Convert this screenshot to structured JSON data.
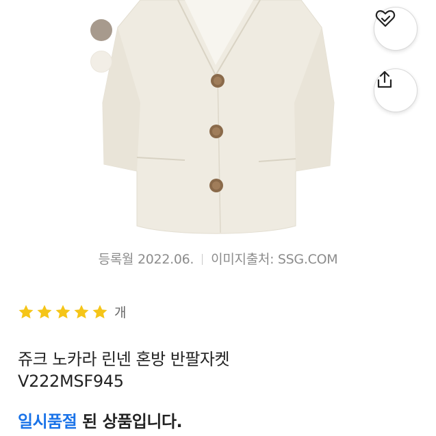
{
  "product": {
    "image_alt": "ivory linen short-sleeve jacket",
    "swatches": [
      {
        "name": "beige",
        "color": "#a79a8d"
      },
      {
        "name": "ivory",
        "color": "#f2eee6"
      }
    ],
    "actions": {
      "wishlist_icon": "heart-check-icon",
      "share_icon": "share-icon"
    }
  },
  "meta": {
    "registered": "등록월 2022.06.",
    "source": "이미지출처: SSG.COM"
  },
  "rating": {
    "stars": 5,
    "count_label": "개"
  },
  "title": "쥬크 노카라 린넨 혼방 반팔자켓",
  "code": "V222MSF945",
  "status": {
    "accent": "일시품절",
    "rest": " 된 상품입니다."
  },
  "colors": {
    "accent": "#1a73e8",
    "star": "#f5c518"
  }
}
